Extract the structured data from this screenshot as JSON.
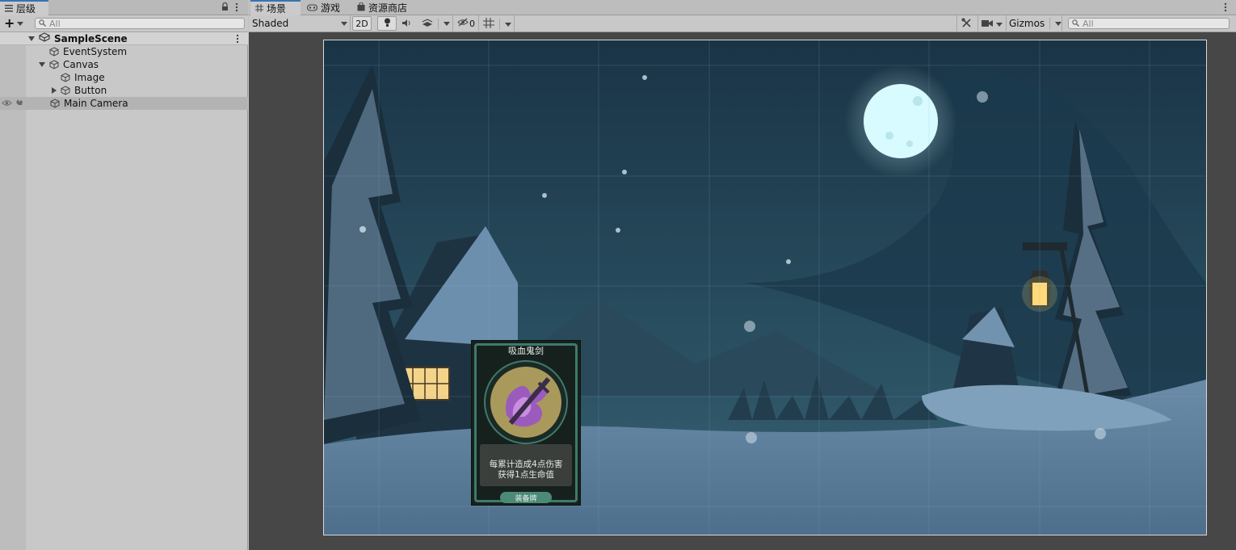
{
  "hierarchy": {
    "tab_label": "层级",
    "add_label": "+",
    "search_placeholder": "All",
    "scene_name": "SampleScene",
    "items": [
      {
        "label": "EventSystem"
      },
      {
        "label": "Canvas"
      },
      {
        "label": "Image"
      },
      {
        "label": "Button"
      },
      {
        "label": "Main Camera"
      }
    ]
  },
  "scene": {
    "tabs": [
      {
        "label": "场景",
        "icon": "grid-icon"
      },
      {
        "label": "游戏",
        "icon": "gamepad-icon"
      },
      {
        "label": "资源商店",
        "icon": "store-bag-icon"
      }
    ],
    "toolbar": {
      "shading_mode": "Shaded",
      "mode_2d": "2D",
      "hidden_count": "0",
      "gizmos_label": "Gizmos",
      "search_placeholder": "All"
    },
    "card": {
      "title": "吸血鬼剑",
      "desc_line1": "每累计造成4点伤害",
      "desc_line2": "获得1点生命值",
      "footer": "装备牌"
    }
  },
  "colors": {
    "accent_tab": "#3a72b0",
    "panel_bg": "#c8c8c8",
    "viewport_bg": "#474747",
    "night_sky": "#1f3b4e",
    "snow": "#5f82a0",
    "moon": "#d7fbff",
    "card_green": "#3f7a6a"
  }
}
